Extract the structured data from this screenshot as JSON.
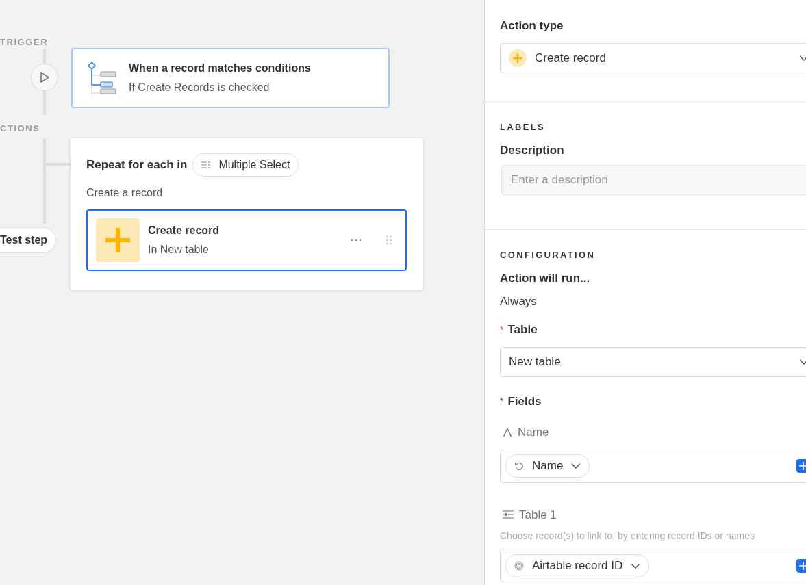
{
  "canvas": {
    "trigger_label": "TRIGGER",
    "actions_label": "CTIONS",
    "test_button": "Test step",
    "trigger": {
      "title": "When a record matches conditions",
      "subtitle": "If Create Records is checked",
      "selected": false
    },
    "repeat": {
      "label": "Repeat for each in",
      "chip": "Multiple Select",
      "sublabel": "Create a record",
      "action": {
        "title": "Create record",
        "subtitle": "In New table",
        "selected": true
      }
    }
  },
  "panel": {
    "action_type": {
      "label": "Action type",
      "value": "Create record"
    },
    "labels": {
      "heading": "LABELS",
      "description_label": "Description",
      "placeholder": "Enter a description"
    },
    "configuration": {
      "heading": "CONFIGURATION",
      "run_label": "Action will run...",
      "run_value": "Always",
      "table": {
        "required_mark": "*",
        "label": "Table",
        "value": "New table"
      },
      "fields": {
        "required_mark": "*",
        "label": "Fields",
        "items": [
          {
            "kind": "text",
            "name": "Name",
            "token": "Name"
          },
          {
            "kind": "link",
            "name": "Table 1",
            "hint": "Choose record(s) to link to, by entering record IDs or names",
            "token": "Airtable record ID"
          }
        ]
      }
    }
  }
}
